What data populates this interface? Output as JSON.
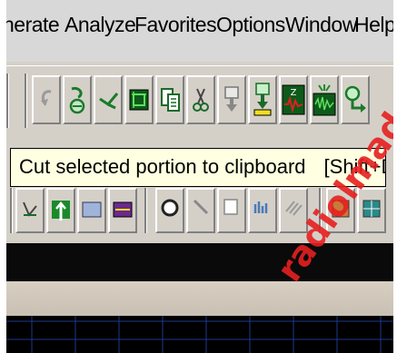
{
  "menu": {
    "items": [
      "nerate",
      "Analyze",
      "Favorites",
      "Options",
      "Window",
      "Help"
    ]
  },
  "toolbar": {
    "buttons": [
      "undo-icon",
      "redo-scope-icon",
      "probe-icon",
      "crop-icon",
      "copy-icon",
      "cut-icon",
      "paste-icon",
      "paste-special-icon",
      "waveform-z-icon",
      "noise-icon",
      "probe-arrow-icon"
    ]
  },
  "tooltip": {
    "text": "Cut selected portion to clipboard",
    "shortcut": "[Shift+Delete]"
  },
  "watermark": {
    "text": "radiolmad"
  },
  "colors": {
    "face": "#d4d0c8",
    "tooltip_bg": "#ffffe1",
    "grid_line": "#1a3a8a",
    "watermark": "#e62020"
  }
}
